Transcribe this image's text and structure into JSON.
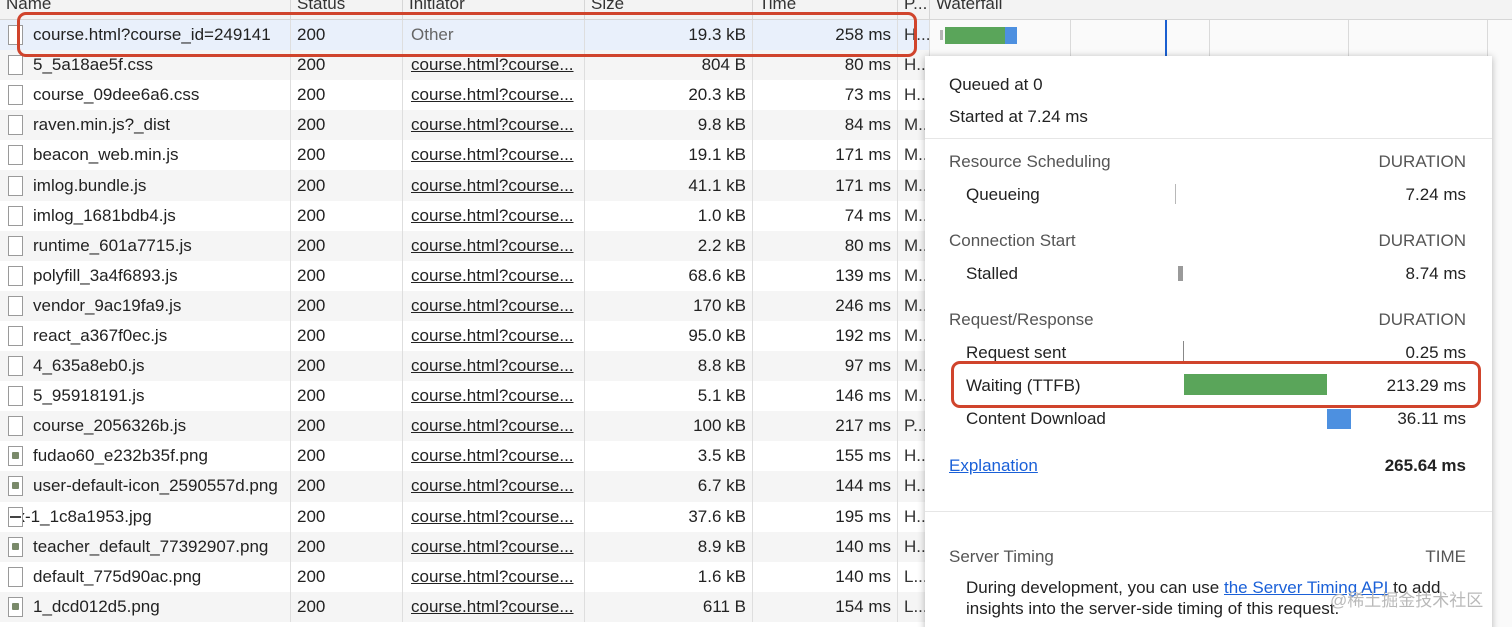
{
  "columns": {
    "name": "Name",
    "status": "Status",
    "initiator": "Initiator",
    "size": "Size",
    "time": "Time",
    "protocol": "P...",
    "waterfall": "Waterfall"
  },
  "requests": [
    {
      "name": "course.html?course_id=249141",
      "status": "200",
      "initiator": "Other",
      "size": "19.3 kB",
      "time": "258 ms",
      "protocol": "H...",
      "icon": "doc-icon"
    },
    {
      "name": "5_5a18ae5f.css",
      "status": "200",
      "initiator": "course.html?course...",
      "size": "804 B",
      "time": "80 ms",
      "protocol": "H...",
      "icon": "doc-icon"
    },
    {
      "name": "course_09dee6a6.css",
      "status": "200",
      "initiator": "course.html?course...",
      "size": "20.3 kB",
      "time": "73 ms",
      "protocol": "H...",
      "icon": "doc-icon"
    },
    {
      "name": "raven.min.js?_dist",
      "status": "200",
      "initiator": "course.html?course...",
      "size": "9.8 kB",
      "time": "84 ms",
      "protocol": "M...",
      "icon": "doc-icon"
    },
    {
      "name": "beacon_web.min.js",
      "status": "200",
      "initiator": "course.html?course...",
      "size": "19.1 kB",
      "time": "171 ms",
      "protocol": "M...",
      "icon": "doc-icon"
    },
    {
      "name": "imlog.bundle.js",
      "status": "200",
      "initiator": "course.html?course...",
      "size": "41.1 kB",
      "time": "171 ms",
      "protocol": "M...",
      "icon": "doc-icon"
    },
    {
      "name": "imlog_1681bdb4.js",
      "status": "200",
      "initiator": "course.html?course...",
      "size": "1.0 kB",
      "time": "74 ms",
      "protocol": "M...",
      "icon": "doc-icon"
    },
    {
      "name": "runtime_601a7715.js",
      "status": "200",
      "initiator": "course.html?course...",
      "size": "2.2 kB",
      "time": "80 ms",
      "protocol": "M...",
      "icon": "doc-icon"
    },
    {
      "name": "polyfill_3a4f6893.js",
      "status": "200",
      "initiator": "course.html?course...",
      "size": "68.6 kB",
      "time": "139 ms",
      "protocol": "M...",
      "icon": "doc-icon"
    },
    {
      "name": "vendor_9ac19fa9.js",
      "status": "200",
      "initiator": "course.html?course...",
      "size": "170 kB",
      "time": "246 ms",
      "protocol": "M...",
      "icon": "doc-icon"
    },
    {
      "name": "react_a367f0ec.js",
      "status": "200",
      "initiator": "course.html?course...",
      "size": "95.0 kB",
      "time": "192 ms",
      "protocol": "M...",
      "icon": "doc-icon"
    },
    {
      "name": "4_635a8eb0.js",
      "status": "200",
      "initiator": "course.html?course...",
      "size": "8.8 kB",
      "time": "97 ms",
      "protocol": "M...",
      "icon": "doc-icon"
    },
    {
      "name": "5_95918191.js",
      "status": "200",
      "initiator": "course.html?course...",
      "size": "5.1 kB",
      "time": "146 ms",
      "protocol": "M...",
      "icon": "doc-icon"
    },
    {
      "name": "course_2056326b.js",
      "status": "200",
      "initiator": "course.html?course...",
      "size": "100 kB",
      "time": "217 ms",
      "protocol": "P...",
      "icon": "doc-icon"
    },
    {
      "name": "fudao60_e232b35f.png",
      "status": "200",
      "initiator": "course.html?course...",
      "size": "3.5 kB",
      "time": "155 ms",
      "protocol": "H...",
      "icon": "image-icon"
    },
    {
      "name": "user-default-icon_2590557d.png",
      "status": "200",
      "initiator": "course.html?course...",
      "size": "6.7 kB",
      "time": "144 ms",
      "protocol": "H...",
      "icon": "image-icon"
    },
    {
      "name": "sx-1_1c8a1953.jpg",
      "status": "200",
      "initiator": "course.html?course...",
      "size": "37.6 kB",
      "time": "195 ms",
      "protocol": "H...",
      "icon": "banner-image-icon"
    },
    {
      "name": "teacher_default_77392907.png",
      "status": "200",
      "initiator": "course.html?course...",
      "size": "8.9 kB",
      "time": "140 ms",
      "protocol": "H...",
      "icon": "image-icon"
    },
    {
      "name": "default_775d90ac.png",
      "status": "200",
      "initiator": "course.html?course...",
      "size": "1.6 kB",
      "time": "140 ms",
      "protocol": "L...",
      "icon": "doc-icon"
    },
    {
      "name": "1_dcd012d5.png",
      "status": "200",
      "initiator": "course.html?course...",
      "size": "611 B",
      "time": "154 ms",
      "protocol": "L...",
      "icon": "image-icon"
    }
  ],
  "timing": {
    "queued_at": "Queued at 0",
    "started_at": "Started at 7.24 ms",
    "duration_header": "DURATION",
    "scheduling": {
      "title": "Resource Scheduling",
      "queueing_label": "Queueing",
      "queueing_value": "7.24 ms"
    },
    "connection": {
      "title": "Connection Start",
      "stalled_label": "Stalled",
      "stalled_value": "8.74 ms"
    },
    "request_response": {
      "title": "Request/Response",
      "request_sent_label": "Request sent",
      "request_sent_value": "0.25 ms",
      "waiting_label": "Waiting (TTFB)",
      "waiting_value": "213.29 ms",
      "download_label": "Content Download",
      "download_value": "36.11 ms"
    },
    "explanation_link": "Explanation",
    "total": "265.64 ms",
    "server_timing": {
      "title": "Server Timing",
      "time_header": "TIME",
      "text_before": "During development, you can use ",
      "link": "the Server Timing API",
      "text_after": " to add insights into the server-side timing of this request."
    },
    "colors": {
      "waiting_bar": "#5aa55a",
      "download_bar": "#4d90e0",
      "highlight_outline": "#d0442c",
      "link": "#1a60d8"
    }
  },
  "watermark": "@稀土掘金技术社区"
}
